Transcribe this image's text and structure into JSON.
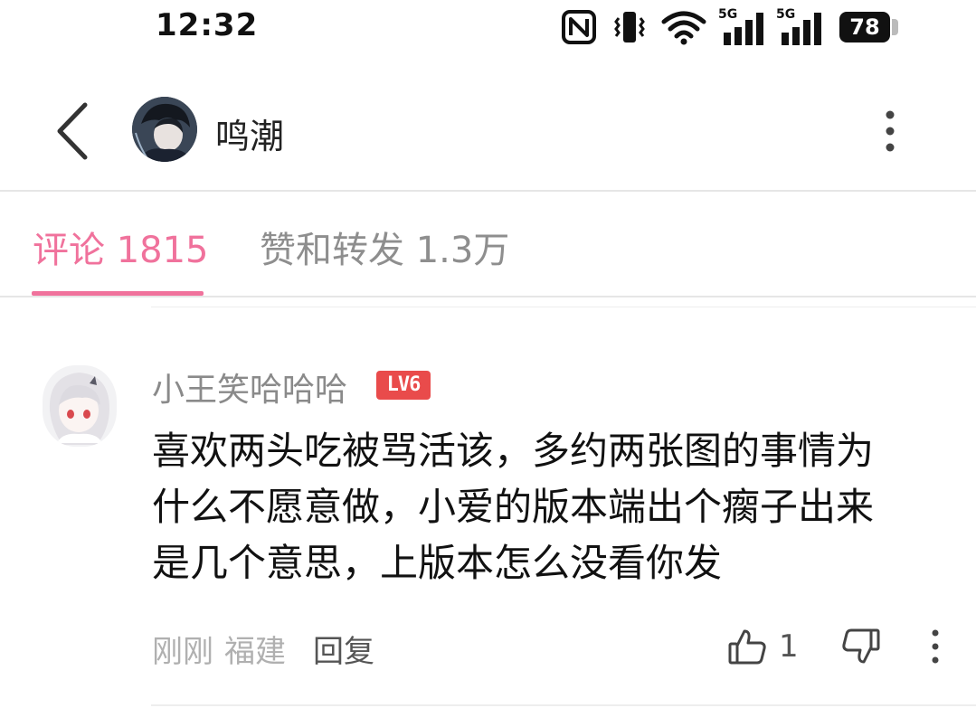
{
  "status_bar": {
    "time": "12:32",
    "battery": "78",
    "icons": [
      "nfc-icon",
      "vibrate-icon",
      "wifi-icon",
      "signal-5g-icon",
      "signal-5g-icon",
      "battery-icon"
    ],
    "signal_label_1": "5G",
    "signal_label_2": "5G"
  },
  "header": {
    "title": "鸣潮",
    "back_icon": "chevron-left-icon",
    "more_icon": "more-vertical-icon"
  },
  "tabs": [
    {
      "label": "评论 1815",
      "active": true
    },
    {
      "label": "赞和转发 1.3万",
      "active": false
    }
  ],
  "colors": {
    "accent": "#f0729c",
    "level_badge": "#e94b4b"
  },
  "comment": {
    "user": "小王笑哈哈哈",
    "level": "LV6",
    "text_lines": [
      "喜欢两头吃被骂活该，多约两张图的事情为",
      "什么不愿意做，小爱的版本端出个瘸子出来",
      "是几个意思，上版本怎么没看你发"
    ],
    "time": "刚刚",
    "location": "福建",
    "reply_label": "回复",
    "likes": "1"
  }
}
